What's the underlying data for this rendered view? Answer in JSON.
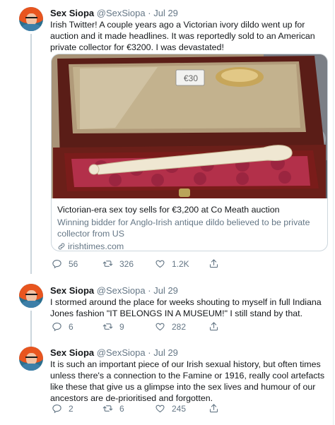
{
  "tweets": [
    {
      "name": "Sex Siopa",
      "handle": "@SexSiopa",
      "separator": "·",
      "date": "Jul 29",
      "text": "Irish Twitter! A couple years ago a Victorian ivory dildo went up for auction and it made headlines. It was reportedly sold to an American private collector for €3200. I was devastated!",
      "card": {
        "price_tag": "€30",
        "title": "Victorian-era sex toy sells for €3,200 at Co Meath auction",
        "description": "Winning bidder for Anglo-Irish antique dildo believed to be private collector from US",
        "domain": "irishtimes.com"
      },
      "replies": "56",
      "retweets": "326",
      "likes": "1.2K"
    },
    {
      "name": "Sex Siopa",
      "handle": "@SexSiopa",
      "separator": "·",
      "date": "Jul 29",
      "text": "I stormed around the place for weeks shouting to myself in full Indiana Jones fashion \"IT BELONGS IN A MUSEUM!\" I still stand by that.",
      "replies": "6",
      "retweets": "9",
      "likes": "282"
    },
    {
      "name": "Sex Siopa",
      "handle": "@SexSiopa",
      "separator": "·",
      "date": "Jul 29",
      "text": "It is such an important piece of our Irish sexual history, but often times unless there's a connection to the Famine or 1916, really cool artefacts like these that give us a glimpse into the sex lives and humour of our ancestors are de-prioritised and forgotten.",
      "replies": "2",
      "retweets": "6",
      "likes": "245"
    }
  ],
  "colors": {
    "text": "#14171a",
    "secondary": "#657786",
    "border": "#ccd6dd"
  },
  "icons": [
    "reply-icon",
    "retweet-icon",
    "like-icon",
    "share-icon",
    "link-icon"
  ]
}
